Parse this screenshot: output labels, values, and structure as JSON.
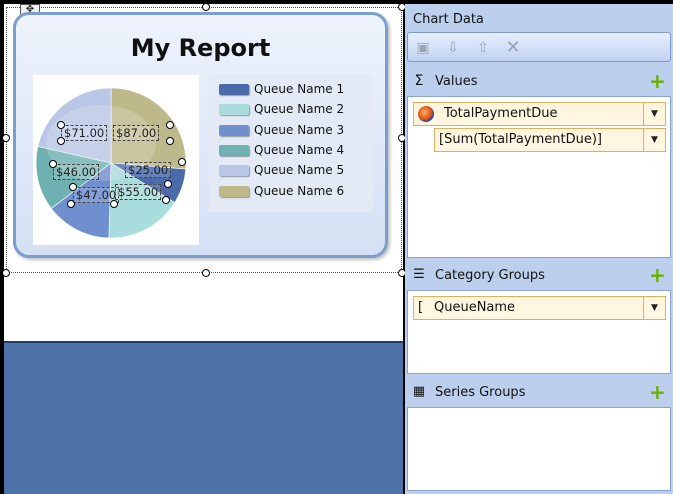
{
  "report": {
    "title": "My Report",
    "legend": [
      {
        "label": "Queue Name 1",
        "color": "#4a6aaa"
      },
      {
        "label": "Queue Name 2",
        "color": "#a9dcdc"
      },
      {
        "label": "Queue Name 3",
        "color": "#6f8fcf"
      },
      {
        "label": "Queue Name 4",
        "color": "#6fb1b1"
      },
      {
        "label": "Queue Name 5",
        "color": "#b9c6e6"
      },
      {
        "label": "Queue Name 6",
        "color": "#bdb98a"
      }
    ],
    "data_labels": [
      "$71.00",
      "$87.00",
      "$46.00",
      "$25.00",
      "$47.00",
      "$55.00"
    ]
  },
  "chart_data": {
    "type": "pie",
    "categories": [
      "Queue Name 1",
      "Queue Name 2",
      "Queue Name 3",
      "Queue Name 4",
      "Queue Name 5",
      "Queue Name 6"
    ],
    "values": [
      25,
      55,
      47,
      46,
      71,
      87
    ],
    "colors": [
      "#4a6aaa",
      "#a9dcdc",
      "#6f8fcf",
      "#6fb1b1",
      "#b9c6e6",
      "#bdb98a"
    ]
  },
  "panel": {
    "title": "Chart Data",
    "toolbar": [
      {
        "icon": "properties-icon"
      },
      {
        "icon": "move-down-icon"
      },
      {
        "icon": "move-up-icon"
      },
      {
        "icon": "delete-icon"
      }
    ],
    "values": {
      "label": "Values",
      "icon": "Σ",
      "field": "TotalPaymentDue",
      "expression": "[Sum(TotalPaymentDue)]"
    },
    "category_groups": {
      "label": "Category Groups",
      "field": "QueueName",
      "field_prefix": "["
    },
    "series_groups": {
      "label": "Series Groups"
    },
    "add_symbol": "+",
    "dropdown_symbol": "▼"
  }
}
